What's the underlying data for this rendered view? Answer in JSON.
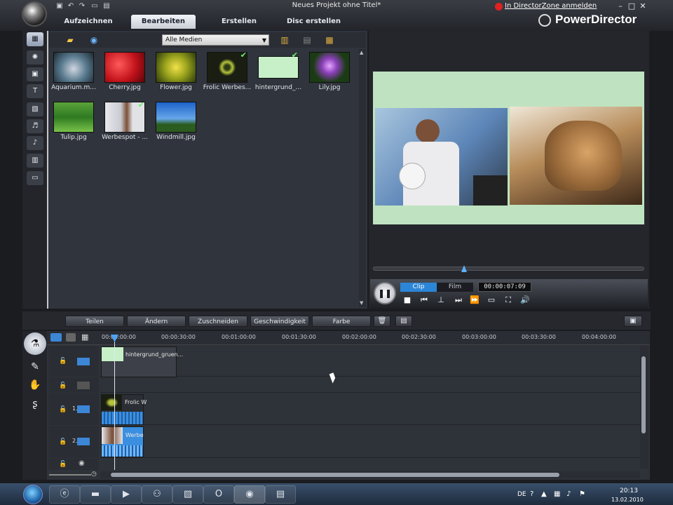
{
  "window": {
    "title": "Neues Projekt ohne Titel*",
    "signin_link": "In DirectorZone anmelden",
    "brand": "PowerDirector",
    "minimize": "–",
    "maximize": "□",
    "close": "✕"
  },
  "tabs": [
    {
      "label": "Aufzeichnen"
    },
    {
      "label": "Bearbeiten",
      "active": true
    },
    {
      "label": "Erstellen"
    },
    {
      "label": "Disc erstellen"
    }
  ],
  "library": {
    "filter_selected": "Alle Medien",
    "items": [
      {
        "label": "Aquarium.m...",
        "checked": false
      },
      {
        "label": "Cherry.jpg",
        "checked": false
      },
      {
        "label": "Flower.jpg",
        "checked": false
      },
      {
        "label": "Frolic Werbes...",
        "checked": true
      },
      {
        "label": "hintergrund_...",
        "checked": true
      },
      {
        "label": "Lily.jpg",
        "checked": false
      },
      {
        "label": "Tulip.jpg",
        "checked": false
      },
      {
        "label": "Werbespot - ...",
        "checked": true
      },
      {
        "label": "Windmill.jpg",
        "checked": false
      }
    ]
  },
  "preview": {
    "mode_clip": "Clip",
    "mode_film": "Film",
    "timecode": "00:00:07:09"
  },
  "edit_toolbar": {
    "split": "Teilen",
    "modify": "Ändern",
    "trim": "Zuschneiden",
    "speed": "Geschwindigkeit",
    "color": "Farbe"
  },
  "timeline": {
    "ruler": [
      "00:00:00:00",
      "00:00:30:00",
      "00:01:00:00",
      "00:01:30:00",
      "00:02:00:00",
      "00:02:30:00",
      "00:03:00:00",
      "00:03:30:00",
      "00:04:00:00"
    ],
    "tracks": [
      {
        "label": "",
        "clip": "hintergrund_gruen..."
      },
      {
        "label": "",
        "clip": ""
      },
      {
        "label": "1.",
        "clip": "Frolic W"
      },
      {
        "label": "2.",
        "clip": "Werbe"
      },
      {
        "label": "",
        "clip": ""
      }
    ]
  },
  "taskbar": {
    "language": "DE",
    "time": "20:13",
    "date": "13.02.2010"
  },
  "colors": {
    "accent": "#2b86d8",
    "stage_bg": "#bfe3c0"
  }
}
